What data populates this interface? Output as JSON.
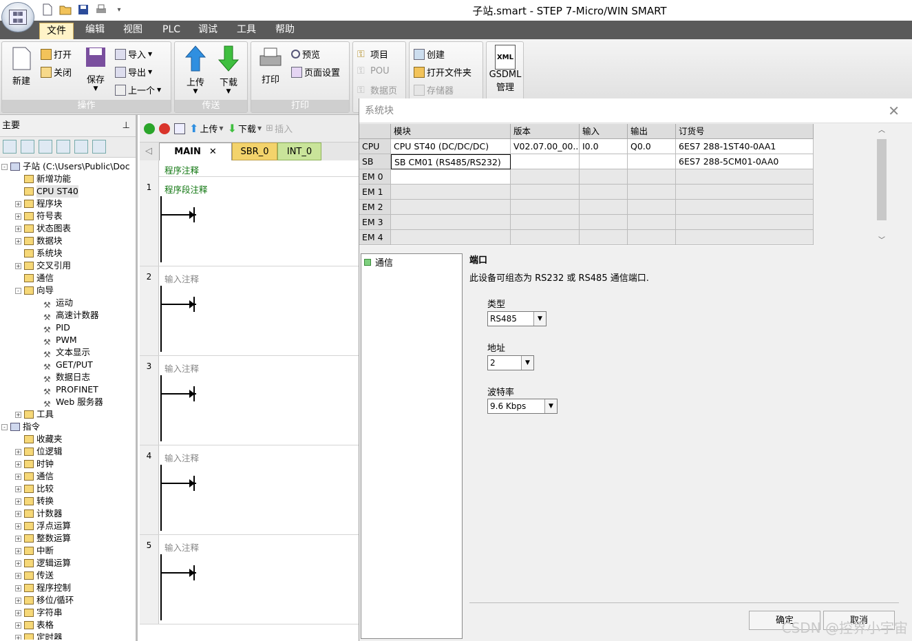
{
  "window": {
    "title": "子站.smart - STEP 7-Micro/WIN SMART"
  },
  "menu": [
    "文件",
    "编辑",
    "视图",
    "PLC",
    "调试",
    "工具",
    "帮助"
  ],
  "ribbon": {
    "groups": [
      "操作",
      "传送",
      "打印"
    ],
    "new": "新建",
    "open": "打开",
    "close": "关闭",
    "save": "保存",
    "import": "导入",
    "export": "导出",
    "previous": "上一个",
    "upload": "上传",
    "download": "下载",
    "print": "打印",
    "preview": "预览",
    "page_setup": "页面设置",
    "project": "项目",
    "pou": "POU",
    "data_page": "数据页",
    "create": "创建",
    "open_folder": "打开文件夹",
    "memory": "存储器",
    "gsdml": "GSDML",
    "gsdml_manage": "管理",
    "xml_icon": "XML"
  },
  "left_panel": {
    "title": "主要",
    "tree": [
      {
        "label": "子站 (C:\\Users\\Public\\Doc",
        "level": 0,
        "exp": "-"
      },
      {
        "label": "新增功能",
        "level": 1,
        "exp": ""
      },
      {
        "label": "CPU ST40",
        "level": 1,
        "exp": "",
        "sel": true
      },
      {
        "label": "程序块",
        "level": 1,
        "exp": "+"
      },
      {
        "label": "符号表",
        "level": 1,
        "exp": "+"
      },
      {
        "label": "状态图表",
        "level": 1,
        "exp": "+"
      },
      {
        "label": "数据块",
        "level": 1,
        "exp": "+"
      },
      {
        "label": "系统块",
        "level": 1,
        "exp": ""
      },
      {
        "label": "交叉引用",
        "level": 1,
        "exp": "+"
      },
      {
        "label": "通信",
        "level": 1,
        "exp": ""
      },
      {
        "label": "向导",
        "level": 1,
        "exp": "-"
      },
      {
        "label": "运动",
        "level": 2,
        "exp": "",
        "wiz": true
      },
      {
        "label": "高速计数器",
        "level": 2,
        "exp": "",
        "wiz": true
      },
      {
        "label": "PID",
        "level": 2,
        "exp": "",
        "wiz": true
      },
      {
        "label": "PWM",
        "level": 2,
        "exp": "",
        "wiz": true
      },
      {
        "label": "文本显示",
        "level": 2,
        "exp": "",
        "wiz": true
      },
      {
        "label": "GET/PUT",
        "level": 2,
        "exp": "",
        "wiz": true
      },
      {
        "label": "数据日志",
        "level": 2,
        "exp": "",
        "wiz": true
      },
      {
        "label": "PROFINET",
        "level": 2,
        "exp": "",
        "wiz": true
      },
      {
        "label": "Web 服务器",
        "level": 2,
        "exp": "",
        "wiz": true
      },
      {
        "label": "工具",
        "level": 1,
        "exp": "+"
      },
      {
        "label": "指令",
        "level": 0,
        "exp": "-"
      },
      {
        "label": "收藏夹",
        "level": 1,
        "exp": ""
      },
      {
        "label": "位逻辑",
        "level": 1,
        "exp": "+"
      },
      {
        "label": "时钟",
        "level": 1,
        "exp": "+"
      },
      {
        "label": "通信",
        "level": 1,
        "exp": "+"
      },
      {
        "label": "比较",
        "level": 1,
        "exp": "+"
      },
      {
        "label": "转换",
        "level": 1,
        "exp": "+"
      },
      {
        "label": "计数器",
        "level": 1,
        "exp": "+"
      },
      {
        "label": "浮点运算",
        "level": 1,
        "exp": "+"
      },
      {
        "label": "整数运算",
        "level": 1,
        "exp": "+"
      },
      {
        "label": "中断",
        "level": 1,
        "exp": "+"
      },
      {
        "label": "逻辑运算",
        "level": 1,
        "exp": "+"
      },
      {
        "label": "传送",
        "level": 1,
        "exp": "+"
      },
      {
        "label": "程序控制",
        "level": 1,
        "exp": "+"
      },
      {
        "label": "移位/循环",
        "level": 1,
        "exp": "+"
      },
      {
        "label": "字符串",
        "level": 1,
        "exp": "+"
      },
      {
        "label": "表格",
        "level": 1,
        "exp": "+"
      },
      {
        "label": "定时器",
        "level": 1,
        "exp": "+"
      }
    ]
  },
  "editor": {
    "toolbar": {
      "upload": "上传",
      "download": "下载",
      "insert": "插入"
    },
    "tabs": [
      "MAIN",
      "SBR_0",
      "INT_0"
    ],
    "close_glyph": "✕",
    "program_comment": "程序注释",
    "networks": [
      {
        "num": "1",
        "comment": "程序段注释"
      },
      {
        "num": "2",
        "comment": "输入注释"
      },
      {
        "num": "3",
        "comment": "输入注释"
      },
      {
        "num": "4",
        "comment": "输入注释"
      },
      {
        "num": "5",
        "comment": "输入注释"
      }
    ]
  },
  "dialog": {
    "title": "系统块",
    "close": "✕",
    "columns": [
      "模块",
      "版本",
      "输入",
      "输出",
      "订货号"
    ],
    "rows": [
      {
        "slot": "CPU",
        "module": "CPU ST40 (DC/DC/DC)",
        "version": "V02.07.00_00....",
        "input": "I0.0",
        "output": "Q0.0",
        "order": "6ES7 288-1ST40-0AA1"
      },
      {
        "slot": "SB",
        "module": "SB CM01 (RS485/RS232)",
        "version": "",
        "input": "",
        "output": "",
        "order": "6ES7 288-5CM01-0AA0"
      },
      {
        "slot": "EM 0",
        "module": "",
        "version": "",
        "input": "",
        "output": "",
        "order": ""
      },
      {
        "slot": "EM 1",
        "module": "",
        "version": "",
        "input": "",
        "output": "",
        "order": ""
      },
      {
        "slot": "EM 2",
        "module": "",
        "version": "",
        "input": "",
        "output": "",
        "order": ""
      },
      {
        "slot": "EM 3",
        "module": "",
        "version": "",
        "input": "",
        "output": "",
        "order": ""
      },
      {
        "slot": "EM 4",
        "module": "",
        "version": "",
        "input": "",
        "output": "",
        "order": ""
      }
    ],
    "left_item": "通信",
    "section_title": "端口",
    "description": "此设备可组态为 RS232 或 RS485 通信端口.",
    "type_label": "类型",
    "type_value": "RS485",
    "address_label": "地址",
    "address_value": "2",
    "baud_label": "波特率",
    "baud_value": "9.6 Kbps",
    "ok": "确定",
    "cancel": "取消"
  },
  "watermark": "CSDN @控界小宇宙"
}
